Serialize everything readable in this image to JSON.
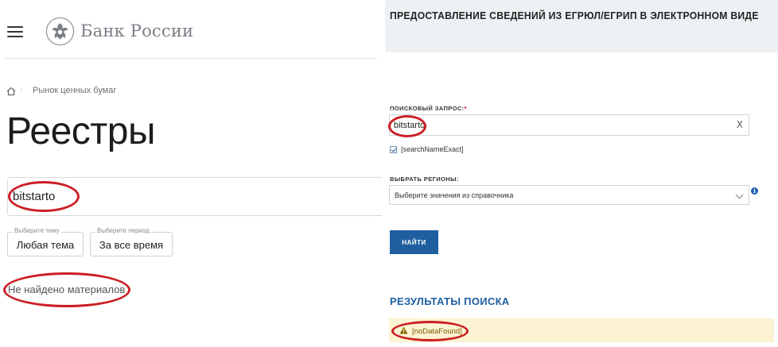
{
  "left_panel": {
    "brand": {
      "name": "Банк России"
    },
    "breadcrumb": {
      "item": "Рынок ценных бумаг"
    },
    "page_title": "Реестры",
    "search": {
      "value": "bitstarto"
    },
    "filters": [
      {
        "caption": "Выберите тему",
        "value": "Любая тема"
      },
      {
        "caption": "Выберите период",
        "value": "За все время"
      }
    ],
    "empty_state": "Не найдено материалов"
  },
  "right_panel": {
    "title": "ПРЕДОСТАВЛЕНИЕ СВЕДЕНИЙ ИЗ ЕГРЮЛ/ЕГРИП В ЭЛЕКТРОННОМ ВИДЕ",
    "search_label": "ПОИСКОВЫЙ ЗАПРОС:",
    "required_mark": "*",
    "search_value": "bitstarto",
    "clear_glyph": "X",
    "checkbox": {
      "label": "[searchNameExact]",
      "checked": true
    },
    "regions_label": "ВЫБРАТЬ РЕГИОНЫ:",
    "regions_placeholder": "Выберите значения из справочника",
    "info_glyph": "i",
    "submit_label": "НАЙТИ",
    "results_title": "РЕЗУЛЬТАТЫ ПОИСКА",
    "alert_text": "[noDataFound]"
  },
  "colors": {
    "highlight_ellipse": "#cc1f25",
    "primary_blue": "#1f5fa0",
    "alert_background": "#fcf3d2"
  },
  "icons": [
    "hamburger-icon",
    "bank-emblem-icon",
    "home-icon",
    "clear-icon",
    "checkbox-check-icon",
    "chevron-down-icon",
    "info-icon",
    "warning-icon"
  ]
}
